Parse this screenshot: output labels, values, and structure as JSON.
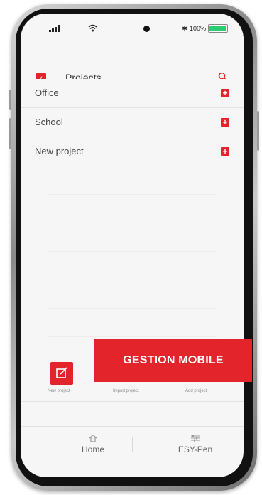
{
  "header": {
    "title": "Projects",
    "back_icon": "back-arrow-icon",
    "search_icon": "search-icon"
  },
  "status_bar": {
    "battery_text": "100%",
    "battery_level": 1.0
  },
  "projects": [
    {
      "label": "Office"
    },
    {
      "label": "School"
    },
    {
      "label": "New project"
    }
  ],
  "actions": {
    "new_project_label": "New project",
    "import_project_label": "Import project",
    "add_project_label": "Add project"
  },
  "tabs": [
    {
      "label": "Home",
      "icon": "home-icon"
    },
    {
      "label": "ESY-Pen",
      "icon": "settings-sliders-icon"
    }
  ],
  "banner": {
    "text": "GESTION MOBILE"
  },
  "colors": {
    "accent": "#e3242b",
    "screen_bg": "#f6f6f6",
    "battery": "#2ecc71"
  }
}
